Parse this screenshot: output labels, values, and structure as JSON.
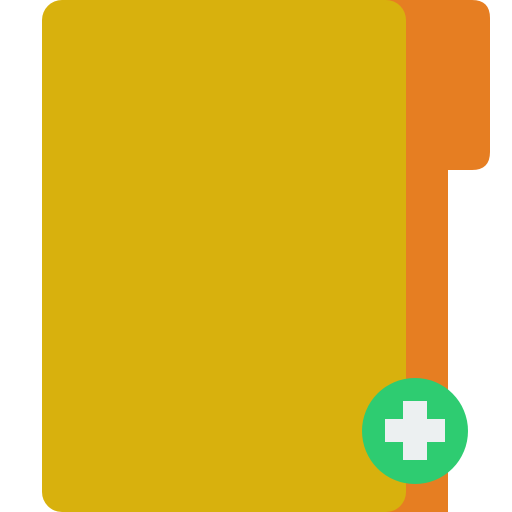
{
  "icon": {
    "name": "new-folder-icon",
    "parts": {
      "folder_back": {
        "name": "folder-back-tab-icon",
        "color": "#E67E22"
      },
      "folder_front": {
        "name": "folder-front-icon",
        "color": "#D8B10D"
      },
      "add_badge": {
        "name": "add-badge-icon",
        "color": "#2ECC71"
      },
      "plus_sign": {
        "name": "plus-icon",
        "color": "#ECF0F1"
      }
    }
  }
}
